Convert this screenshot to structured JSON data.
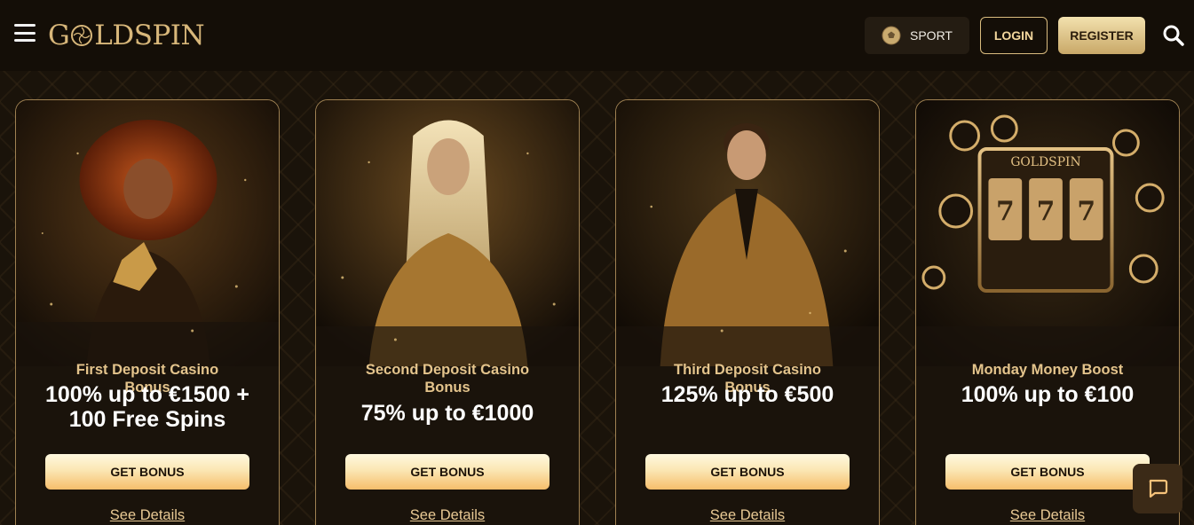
{
  "header": {
    "brand": "GOLDSPIN",
    "sport_label": "SPORT",
    "login_label": "LOGIN",
    "register_label": "REGISTER"
  },
  "cards": [
    {
      "subtitle": "First Deposit Casino Bonus",
      "offer": "100% up to €1500 + 100 Free Spins",
      "button": "GET BONUS",
      "details": "See Details"
    },
    {
      "subtitle": "Second Deposit Casino Bonus",
      "offer": "75% up to €1000",
      "button": "GET BONUS",
      "details": "See Details"
    },
    {
      "subtitle": "Third Deposit Casino Bonus",
      "offer": "125% up to €500",
      "button": "GET BONUS",
      "details": "See Details"
    },
    {
      "subtitle": "Monday Money Boost",
      "offer": "100% up to €100",
      "button": "GET BONUS",
      "details": "See Details"
    }
  ],
  "slot_logo": "GOLDSPIN",
  "slot_reels": [
    "7",
    "7",
    "7"
  ],
  "colors": {
    "accent_gold": "#d9bb7e",
    "background": "#17110a",
    "button_gradient_bottom": "#f6bd6b"
  }
}
